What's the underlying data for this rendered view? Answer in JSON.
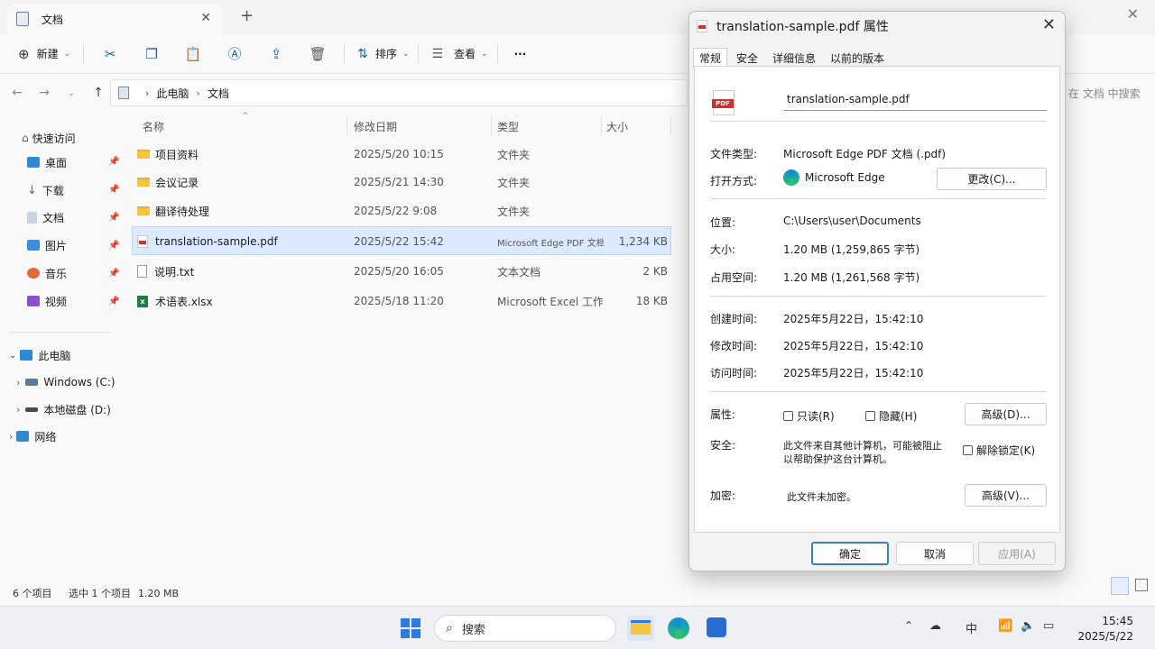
{
  "explorer": {
    "tab_title": "文档",
    "toolbar": {
      "new_label": "新建",
      "sort_label": "排序",
      "view_label": "查看",
      "more_label": "···"
    },
    "breadcrumb": [
      "此电脑",
      "文档"
    ],
    "search_placeholder": "在 文档 中搜索",
    "sidebar": {
      "quick_access": "快速访问",
      "pinned": [
        "桌面",
        "下载",
        "文档",
        "图片",
        "音乐",
        "视频"
      ],
      "this_pc": "此电脑",
      "drives": [
        "Windows (C:)",
        "本地磁盘 (D:)"
      ],
      "network": "网络"
    },
    "columns": [
      "名称",
      "修改日期",
      "类型",
      "大小"
    ],
    "files": [
      {
        "name": "项目资料",
        "date": "2025/5/20 10:15",
        "type": "文件夹",
        "size": ""
      },
      {
        "name": "会议记录",
        "date": "2025/5/21 14:30",
        "type": "文件夹",
        "size": ""
      },
      {
        "name": "翻译待处理",
        "date": "2025/5/22 9:08",
        "type": "文件夹",
        "size": ""
      },
      {
        "name": "translation-sample.pdf",
        "date": "2025/5/22 15:42",
        "type": "Microsoft Edge PDF 文档",
        "size": "1,234 KB"
      },
      {
        "name": "说明.txt",
        "date": "2025/5/20 16:05",
        "type": "文本文档",
        "size": "2 KB"
      },
      {
        "name": "术语表.xlsx",
        "date": "2025/5/18 11:20",
        "type": "Microsoft Excel 工作表",
        "size": "18 KB"
      }
    ],
    "status": {
      "count": "6 个项目",
      "selection": "选中 1 个项目",
      "selection_size": "1.20 MB"
    }
  },
  "dialog": {
    "title": "translation-sample.pdf 属性",
    "tabs": [
      "常规",
      "安全",
      "详细信息",
      "以前的版本"
    ],
    "pdf_icon_text": "PDF",
    "file_name": "translation-sample.pdf",
    "file_type_label": "文件类型:",
    "file_type": "Microsoft Edge PDF 文档 (.pdf)",
    "opens_with_label": "打开方式:",
    "opens_with": "Microsoft Edge",
    "change_button": "更改(C)...",
    "location_label": "位置:",
    "location": "C:\\Users\\user\\Documents",
    "size_label": "大小:",
    "size": "1.20 MB (1,259,865 字节)",
    "size_on_disk_label": "占用空间:",
    "size_on_disk": "1.20 MB (1,261,568 字节)",
    "created_label": "创建时间:",
    "created": "2025年5月22日，15:42:10",
    "modified_label": "修改时间:",
    "modified": "2025年5月22日，15:42:10",
    "accessed_label": "访问时间:",
    "accessed": "2025年5月22日，15:42:10",
    "attributes_label": "属性:",
    "readonly_label": "只读(R)",
    "hidden_label": "隐藏(H)",
    "advanced_button": "高级(D)...",
    "security_label": "安全:",
    "security_text_1": "此文件来自其他计算机，可能被阻止",
    "security_text_2": "以帮助保护这台计算机。",
    "unblock_label": "解除锁定(K)",
    "encryption_label": "加密:",
    "encryption_text": "此文件未加密。",
    "encryption_advanced_button": "高级(V)...",
    "ok_button": "确定",
    "cancel_button": "取消",
    "apply_button": "应用(A)"
  },
  "taskbar": {
    "search_placeholder": "搜索",
    "ime": "中",
    "time": "15:45",
    "date": "2025/5/22"
  }
}
